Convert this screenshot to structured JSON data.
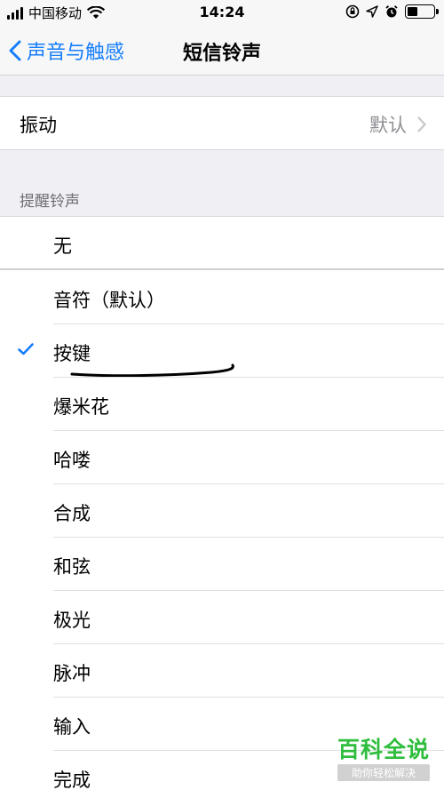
{
  "status_bar": {
    "carrier": "中国移动",
    "time": "14:24"
  },
  "nav": {
    "back_label": "声音与触感",
    "title": "短信铃声"
  },
  "vibration": {
    "label": "振动",
    "value": "默认"
  },
  "section_header": "提醒铃声",
  "tones": [
    {
      "label": "无",
      "selected": false
    },
    {
      "label": "音符（默认）",
      "selected": false
    },
    {
      "label": "按键",
      "selected": true
    },
    {
      "label": "爆米花",
      "selected": false
    },
    {
      "label": "哈喽",
      "selected": false
    },
    {
      "label": "合成",
      "selected": false
    },
    {
      "label": "和弦",
      "selected": false
    },
    {
      "label": "极光",
      "selected": false
    },
    {
      "label": "脉冲",
      "selected": false
    },
    {
      "label": "输入",
      "selected": false
    },
    {
      "label": "完成",
      "selected": false
    }
  ],
  "watermark": {
    "title": "百科全说",
    "subtitle": "助你轻松解决"
  },
  "colors": {
    "accent": "#157efb",
    "watermark_green": "#2ebd3d"
  }
}
